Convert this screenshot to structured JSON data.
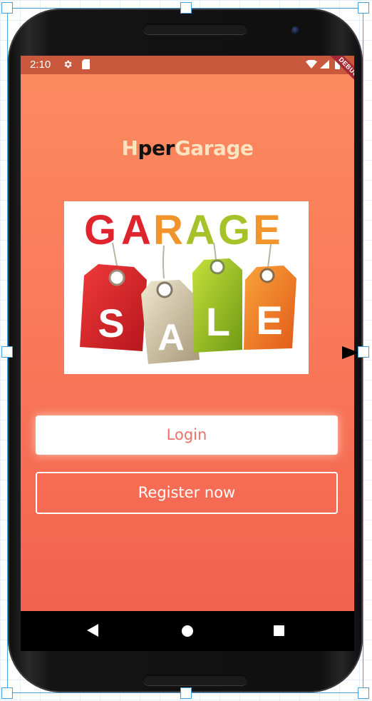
{
  "status_bar": {
    "time": "2:10",
    "icons": [
      "gear-icon",
      "sd-card-icon",
      "wifi-icon",
      "signal-icon",
      "battery-icon"
    ],
    "debug_banner": "DEBUG"
  },
  "app": {
    "brand": {
      "part1": "H",
      "part2": "per",
      "part3": "Garage"
    },
    "hero_image": {
      "word_top": "GARAGE",
      "tag_letters": [
        "S",
        "A",
        "L",
        "E"
      ]
    },
    "login_label": "Login",
    "register_label": "Register now"
  },
  "nav_bar": {
    "icons": [
      "back-icon",
      "home-icon",
      "recents-icon"
    ]
  },
  "colors": {
    "status_bar": "#c9583d",
    "background_top": "#fb8b5f",
    "background_bottom": "#f3614f",
    "button_text": "#f07068",
    "brand_light": "#fde3bf",
    "brand_dark": "#111111",
    "selection": "#4a9fd8"
  }
}
